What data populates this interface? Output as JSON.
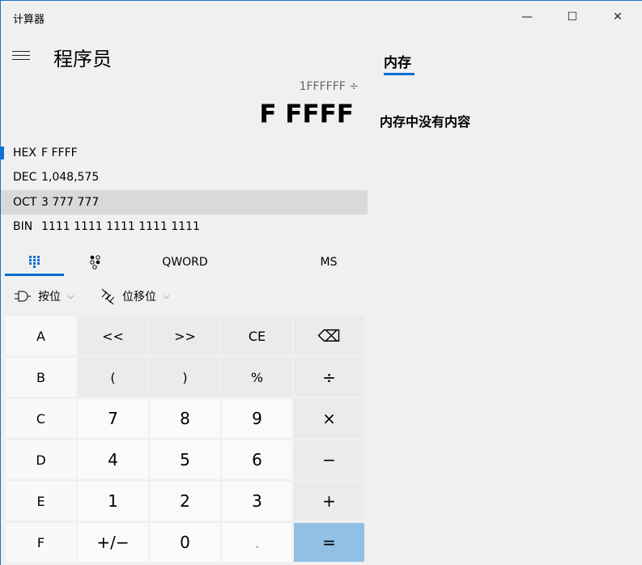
{
  "window": {
    "title": "计算器",
    "minimize": "—",
    "maximize": "☐",
    "close": "✕"
  },
  "header": {
    "mode": "程序员"
  },
  "display": {
    "expression": "1FFFFFF ÷",
    "value": "F FFFF"
  },
  "radix": [
    {
      "name": "HEX",
      "value": "F FFFF"
    },
    {
      "name": "DEC",
      "value": "1,048,575"
    },
    {
      "name": "OCT",
      "value": "3 777 777"
    },
    {
      "name": "BIN",
      "value": "1111 1111 1111 1111 1111"
    }
  ],
  "tabs": {
    "word_size": "QWORD",
    "memory_store": "MS"
  },
  "dropdowns": {
    "bitwise": "按位",
    "bitshift": "位移位",
    "chevron": "⌵"
  },
  "keys": [
    [
      "A",
      "<<",
      ">>",
      "CE",
      "⌫"
    ],
    [
      "B",
      "(",
      ")",
      "%",
      "÷"
    ],
    [
      "C",
      "7",
      "8",
      "9",
      "×"
    ],
    [
      "D",
      "4",
      "5",
      "6",
      "−"
    ],
    [
      "E",
      "1",
      "2",
      "3",
      "+"
    ],
    [
      "F",
      "+/−",
      "0",
      ".",
      "="
    ]
  ],
  "memory": {
    "tab": "内存",
    "empty": "内存中没有内容"
  }
}
